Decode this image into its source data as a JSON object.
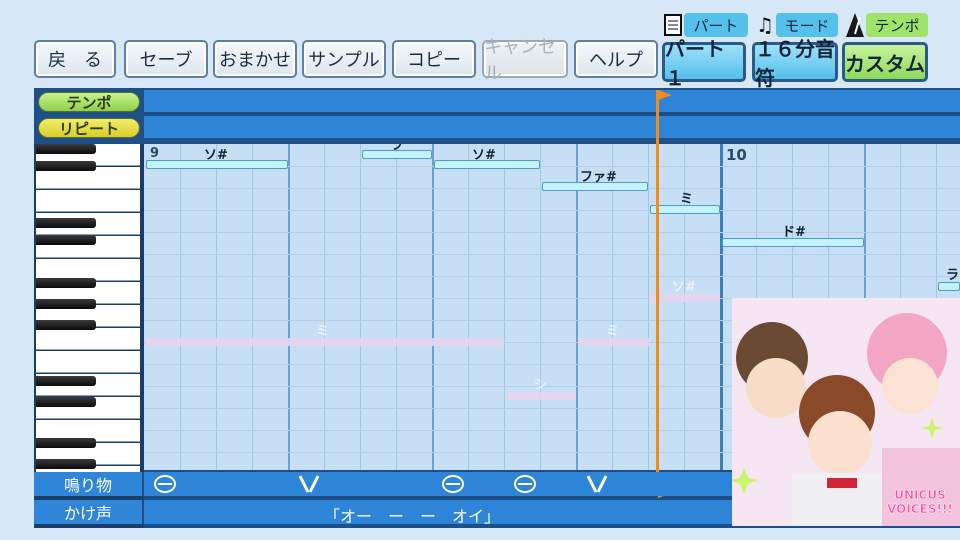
{
  "toolbar": {
    "back": "戻　る",
    "save": "セーブ",
    "auto": "おまかせ",
    "sample": "サンプル",
    "copy": "コピー",
    "cancel": "キャンセル",
    "help": "ヘルプ"
  },
  "modes": {
    "part_label": "パート",
    "part_value": "パート１",
    "mode_label": "モード",
    "mode_value": "１６分音符",
    "tempo_label": "テンポ",
    "tempo_value": "カスタム"
  },
  "editor": {
    "tempo_row": "テンポ",
    "repeat_row": "リピート",
    "measure_start": "9",
    "measure_next": "10",
    "notes": [
      "ソ#",
      "ラ",
      "ソ#",
      "ファ#",
      "ミ",
      "ド#",
      "ラ"
    ],
    "ghost_notes": [
      "ミ",
      "ミ",
      "シ",
      "ソ#"
    ],
    "sound_row": "鳴り物",
    "chant_row": "かけ声",
    "chant_text": "「オー　ー　ー　オイ」"
  },
  "thumbnail": {
    "logo_text": "UNICUS VOICES!!!"
  },
  "colors": {
    "accent": "#f08c1c",
    "band": "#2e84d6",
    "grid": "#c7dff5",
    "note": "#c6f2fb",
    "mode_part": "#55c0ea",
    "mode_tempo": "#9fe36a"
  }
}
